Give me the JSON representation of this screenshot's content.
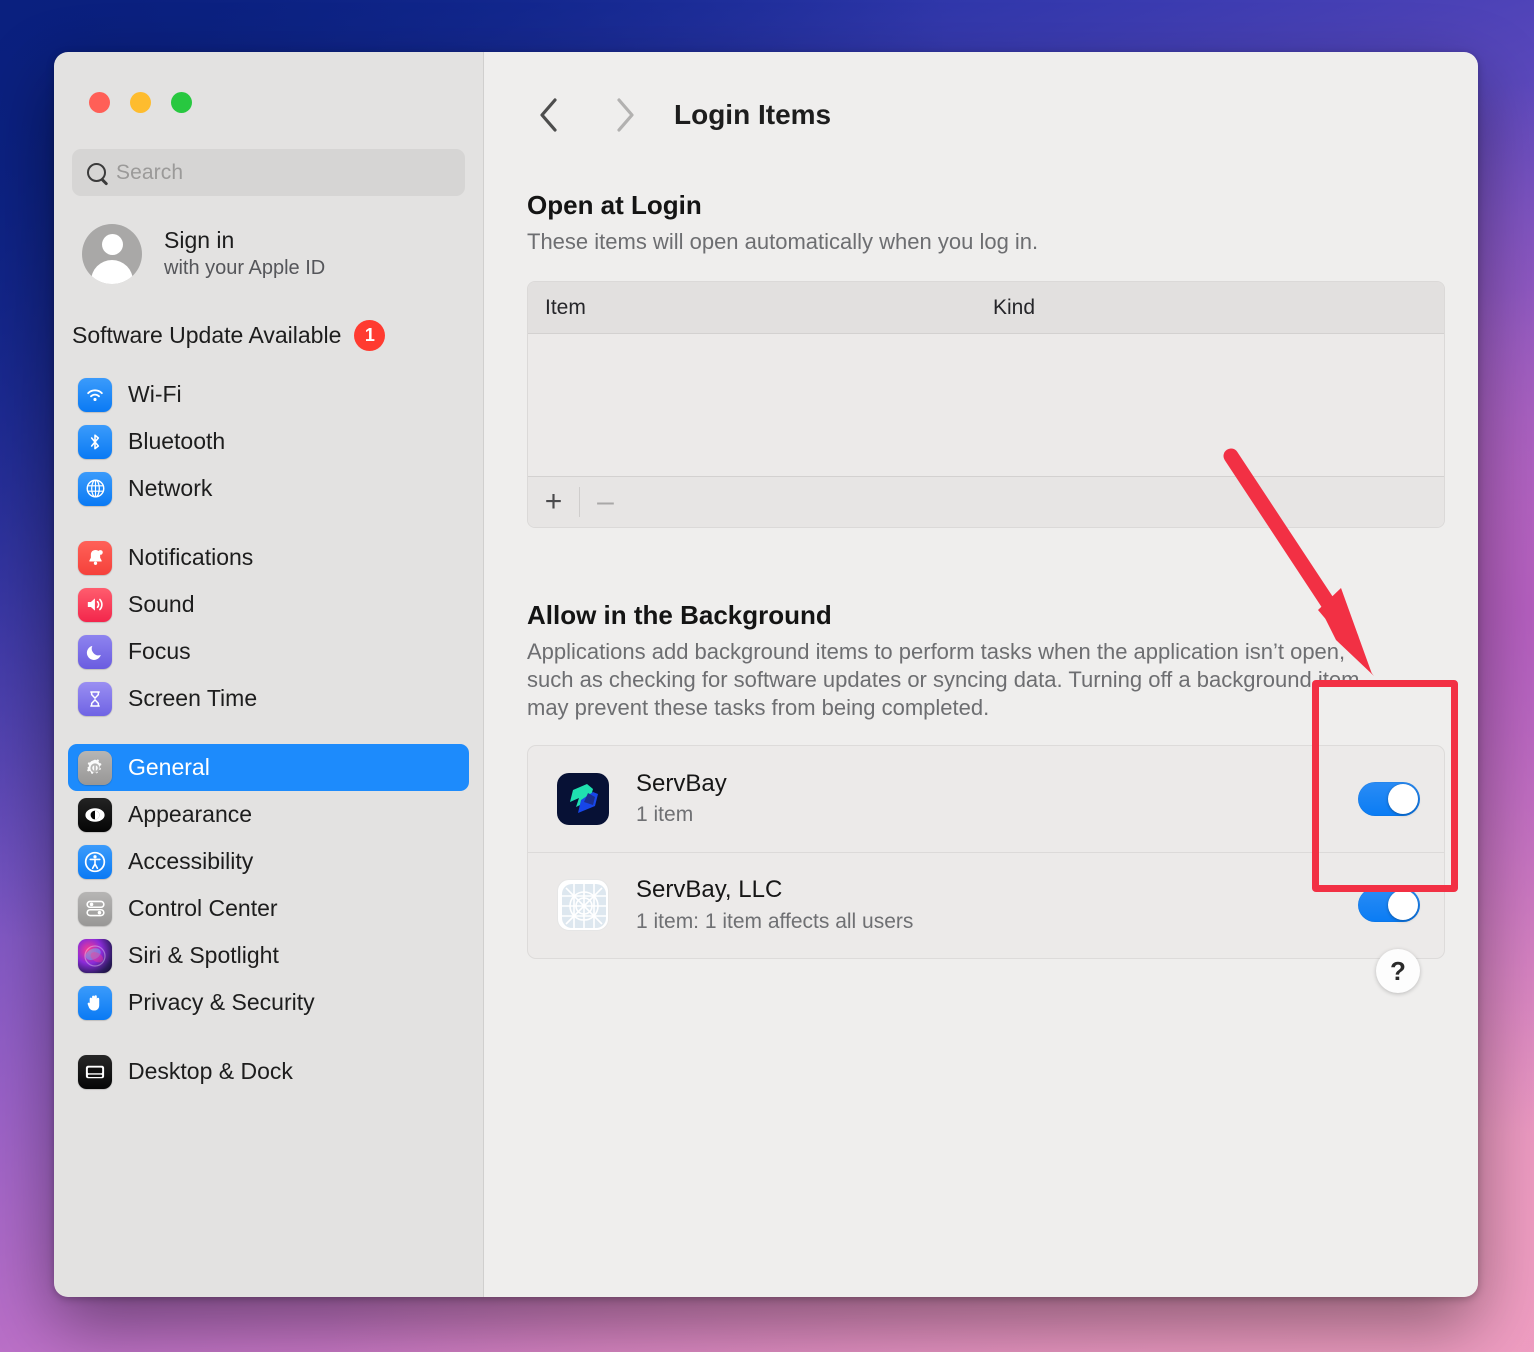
{
  "window": {
    "traffic_lights": [
      {
        "name": "close",
        "color": "#ff5f57"
      },
      {
        "name": "minimize",
        "color": "#febc2e"
      },
      {
        "name": "maximize",
        "color": "#28c840"
      }
    ]
  },
  "sidebar": {
    "search": {
      "placeholder": "Search"
    },
    "account": {
      "title": "Sign in",
      "subtitle": "with your Apple ID"
    },
    "software_update": {
      "label": "Software Update Available",
      "badge": "1"
    },
    "groups": [
      {
        "items": [
          {
            "label": "Wi-Fi",
            "icon": "wifi-icon",
            "selected": false
          },
          {
            "label": "Bluetooth",
            "icon": "bluetooth-icon",
            "selected": false
          },
          {
            "label": "Network",
            "icon": "network-icon",
            "selected": false
          }
        ]
      },
      {
        "items": [
          {
            "label": "Notifications",
            "icon": "bell-icon",
            "selected": false
          },
          {
            "label": "Sound",
            "icon": "speaker-icon",
            "selected": false
          },
          {
            "label": "Focus",
            "icon": "moon-icon",
            "selected": false
          },
          {
            "label": "Screen Time",
            "icon": "hourglass-icon",
            "selected": false
          }
        ]
      },
      {
        "items": [
          {
            "label": "General",
            "icon": "gear-icon",
            "selected": true
          },
          {
            "label": "Appearance",
            "icon": "appearance-icon",
            "selected": false
          },
          {
            "label": "Accessibility",
            "icon": "accessibility-icon",
            "selected": false
          },
          {
            "label": "Control Center",
            "icon": "control-center-icon",
            "selected": false
          },
          {
            "label": "Siri & Spotlight",
            "icon": "siri-icon",
            "selected": false
          },
          {
            "label": "Privacy & Security",
            "icon": "hand-icon",
            "selected": false
          }
        ]
      },
      {
        "items": [
          {
            "label": "Desktop & Dock",
            "icon": "desktop-dock-icon",
            "selected": false
          }
        ]
      }
    ]
  },
  "main": {
    "nav": {
      "back": "back-chevron",
      "forward": "forward-chevron"
    },
    "title": "Login Items",
    "open_at_login": {
      "heading": "Open at Login",
      "description": "These items will open automatically when you log in.",
      "columns": [
        "Item",
        "Kind"
      ],
      "rows": [],
      "add_label": "+",
      "remove_label": "–"
    },
    "allow_background": {
      "heading": "Allow in the Background",
      "description": "Applications add background items to perform tasks when the application isn’t open, such as checking for software updates or syncing data. Turning off a background item may prevent these tasks from being completed.",
      "rows": [
        {
          "title": "ServBay",
          "subtitle": "1 item",
          "icon": "servbay-app-icon",
          "toggle_on": true
        },
        {
          "title": "ServBay, LLC",
          "subtitle": "1 item: 1 item affects all users",
          "icon": "generic-bundle-icon",
          "toggle_on": true
        }
      ]
    },
    "help_label": "?"
  },
  "annotation": {
    "highlight_color": "#f23044",
    "arrow": "red-arrow-pointing-to-toggles",
    "box": "red-rectangle-around-toggles"
  }
}
